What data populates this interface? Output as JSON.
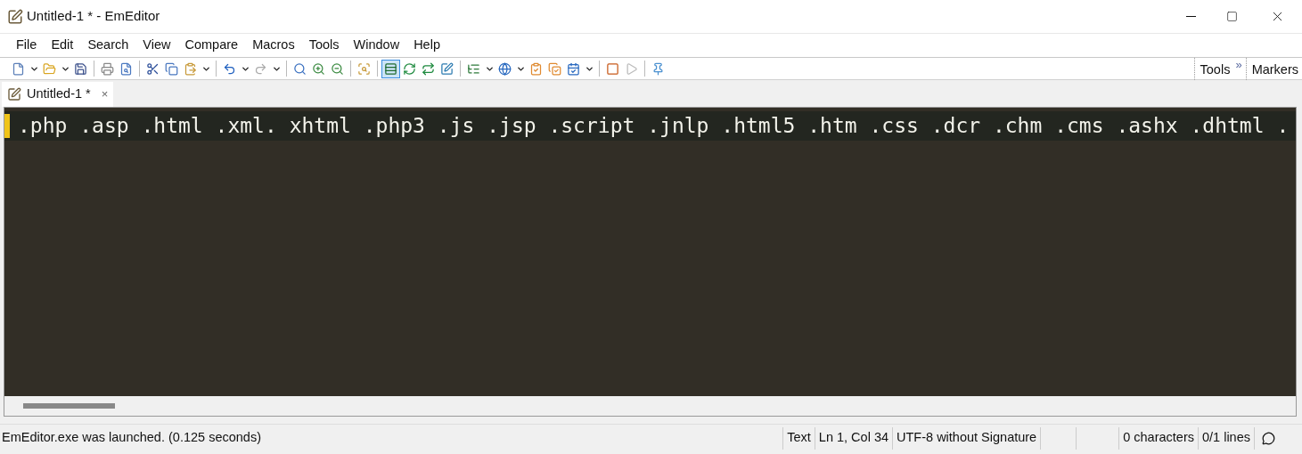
{
  "window": {
    "title": "Untitled-1 * - EmEditor"
  },
  "menu": [
    "File",
    "Edit",
    "Search",
    "View",
    "Compare",
    "Macros",
    "Tools",
    "Window",
    "Help"
  ],
  "toolbar_panels": [
    {
      "label": "Tools",
      "chevron": "»"
    },
    {
      "label": "Markers"
    }
  ],
  "tabs": [
    {
      "label": "Untitled-1 *",
      "selected": true,
      "close": "×"
    }
  ],
  "editor": {
    "lines": [
      {
        "text": ".php .asp .html .xml. xhtml .php3 .js .jsp .script .jnlp .html5 .htm .css .dcr .chm .cms .ashx .dhtml .",
        "current": true
      }
    ]
  },
  "status_bar": {
    "message": "EmEditor.exe was launched. (0.125 seconds)",
    "segments": [
      "Text",
      "Ln 1, Col 34",
      "UTF-8 without Signature",
      "0 characters",
      "0/1 lines"
    ]
  }
}
